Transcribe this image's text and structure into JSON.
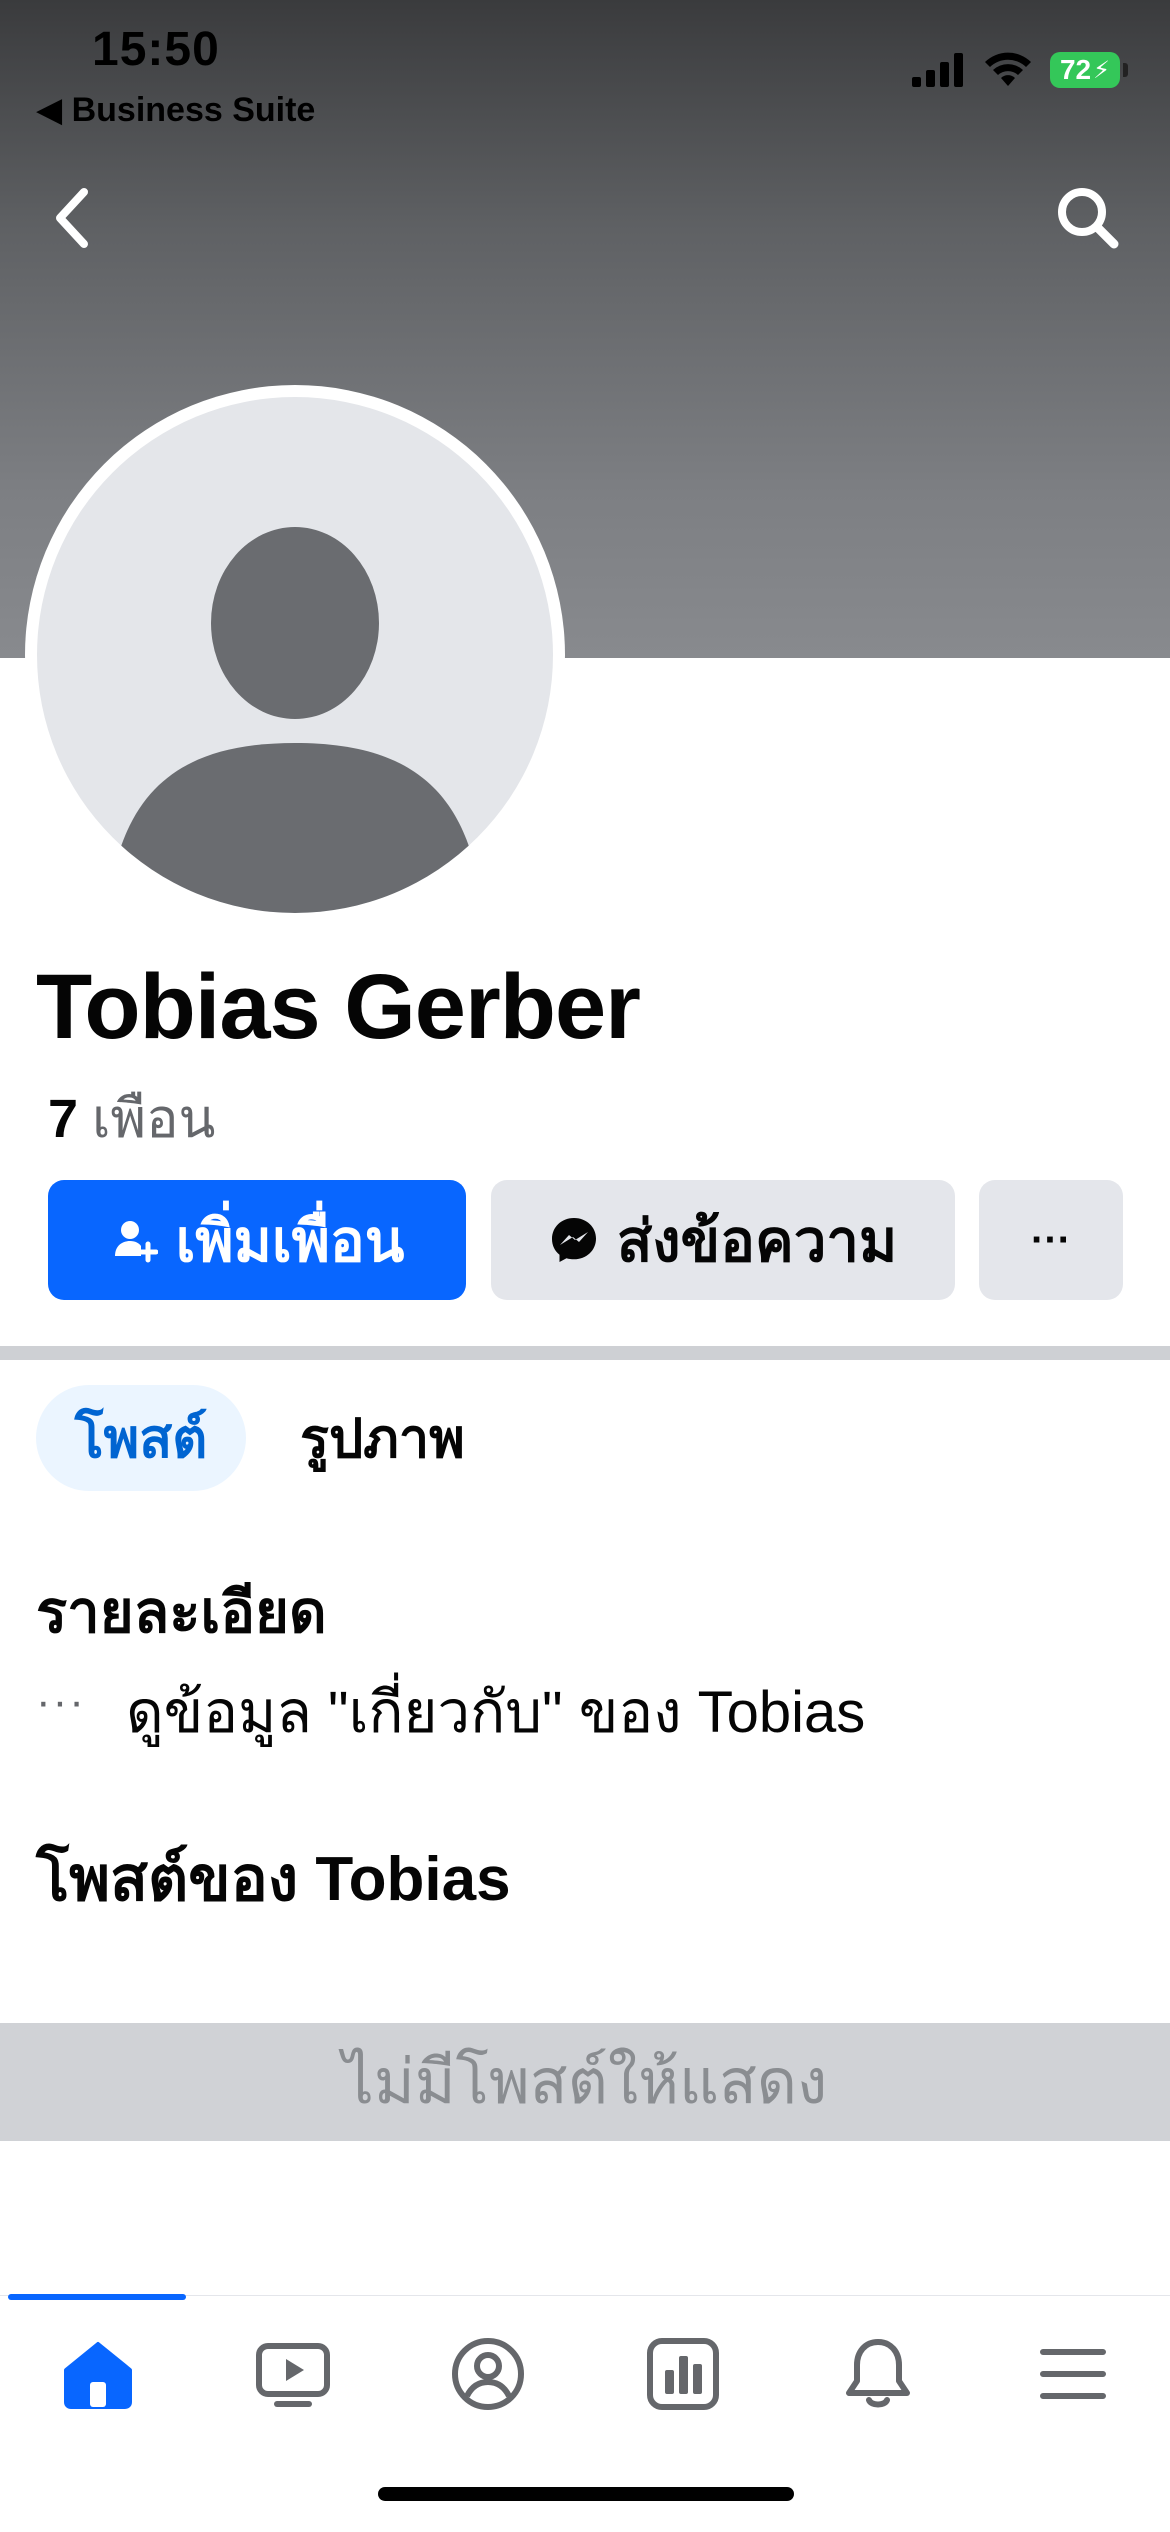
{
  "status_bar": {
    "time": "15:50",
    "back_app": "◀ Business Suite",
    "battery": "72"
  },
  "profile": {
    "name": "Tobias Gerber",
    "friends_count": "7",
    "friends_label": "เพือน"
  },
  "actions": {
    "add_friend": "เพิ่มเพื่อน",
    "message": "ส่งข้อความ",
    "more": "···"
  },
  "tabs": [
    {
      "label": "โพสต์",
      "active": true
    },
    {
      "label": "รูปภาพ",
      "active": false
    }
  ],
  "details": {
    "title": "รายละเอียด",
    "dots": "···",
    "about_link": "ดูข้อมูล \"เกี่ยวกับ\" ของ Tobias"
  },
  "posts": {
    "title": "โพสต์ของ Tobias",
    "empty_message": "ไม่มีโพสต์ให้แสดง"
  },
  "bottom_nav": [
    {
      "icon": "home-icon",
      "active": true
    },
    {
      "icon": "video-icon",
      "active": false
    },
    {
      "icon": "profile-icon",
      "active": false
    },
    {
      "icon": "dashboard-icon",
      "active": false
    },
    {
      "icon": "bell-icon",
      "active": false
    },
    {
      "icon": "menu-icon",
      "active": false
    }
  ],
  "colors": {
    "accent": "#0866ff",
    "tab_active_bg": "#ebf5ff",
    "button_secondary": "#e4e6eb",
    "battery": "#34c759"
  }
}
